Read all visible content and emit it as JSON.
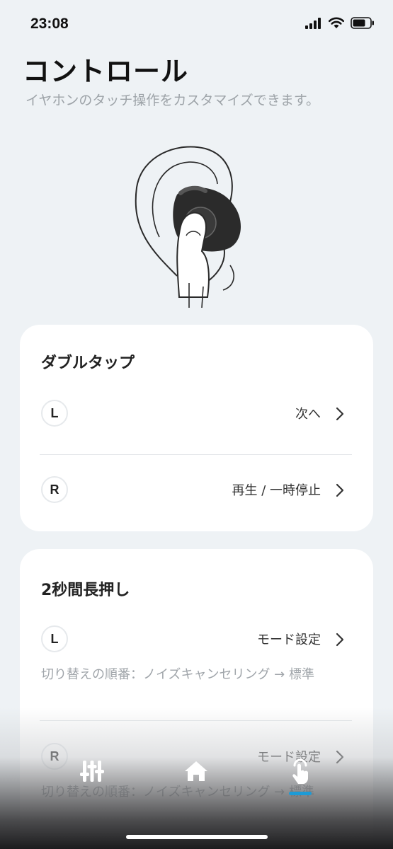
{
  "status_bar": {
    "time": "23:08"
  },
  "header": {
    "title": "コントロール",
    "subtitle": "イヤホンのタッチ操作をカスタマイズできます。"
  },
  "double_tap": {
    "title": "ダブルタップ",
    "left": {
      "badge": "L",
      "value": "次へ"
    },
    "right": {
      "badge": "R",
      "value": "再生 / 一時停止"
    }
  },
  "long_press": {
    "title": "2秒間長押し",
    "left": {
      "badge": "L",
      "value": "モード設定",
      "note": "切り替えの順番：ノイズキャンセリング → 標準"
    },
    "right": {
      "badge": "R",
      "value": "モード設定",
      "note": "切り替えの順番：ノイズキャンセリング → 標準"
    }
  },
  "tab_bar": {
    "items": [
      {
        "icon": "equalizer-icon"
      },
      {
        "icon": "home-icon"
      },
      {
        "icon": "touch-control-icon",
        "selected": true
      }
    ],
    "accent": "#1d9bd7"
  }
}
